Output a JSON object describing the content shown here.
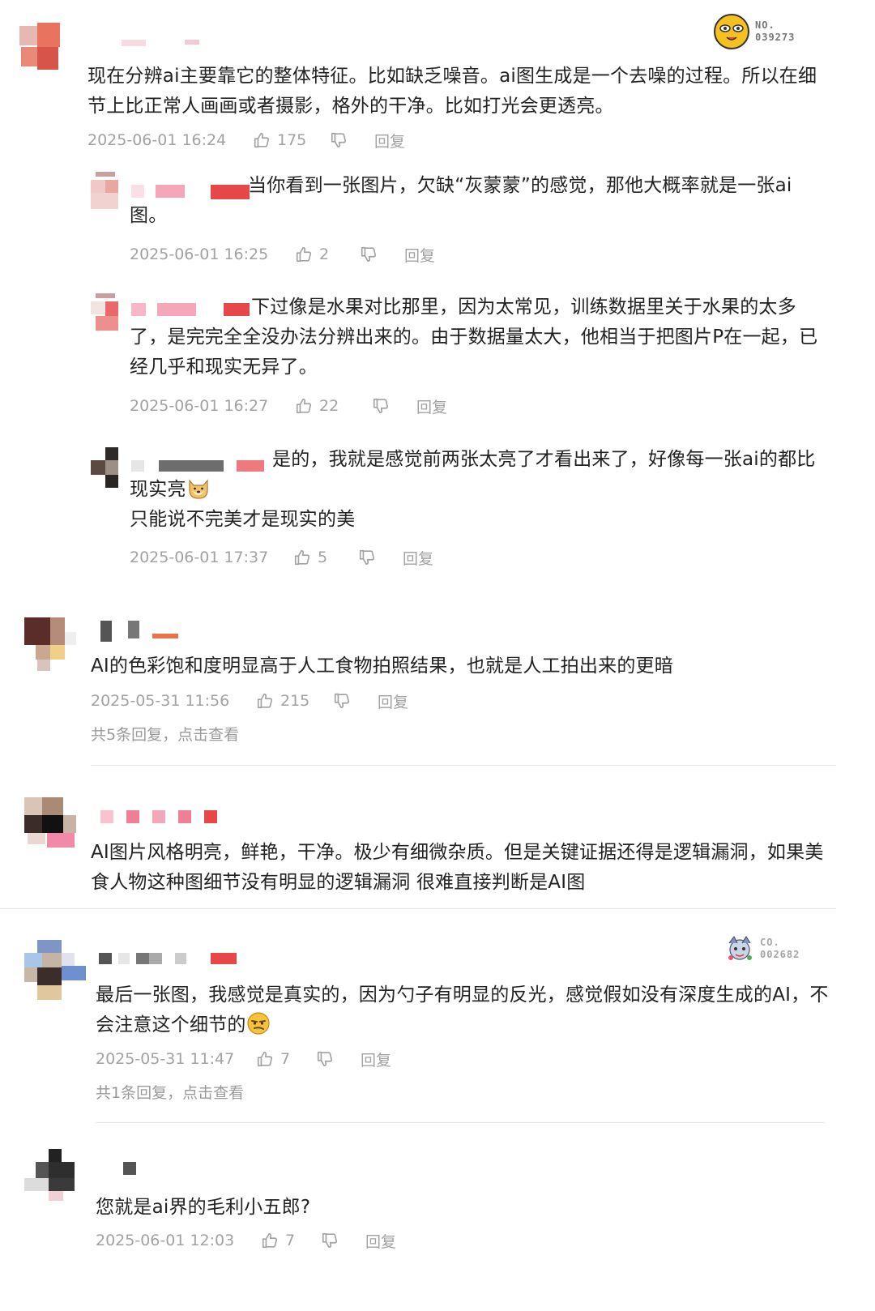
{
  "comments": [
    {
      "text_lines": [
        "现在分辨ai主要靠它的整体特征。比如缺乏噪音。ai图生成是一个去噪的过程。所以在细",
        "节上比正常人画画或者摄影，格外的干净。比如打光会更透亮。"
      ],
      "time": "2025-06-01 16:24",
      "likes": "175",
      "reply_label": "回复",
      "badge": {
        "line1": "NO.",
        "line2": "039273"
      }
    },
    {
      "text_lines": [
        "当你看到一张图片，欠缺“灰蒙蒙”的感觉，那他大概率就是一张ai",
        "图。"
      ],
      "time": "2025-06-01 16:25",
      "likes": "2",
      "reply_label": "回复"
    },
    {
      "text_lines": [
        "下过像是水果对比那里，因为太常见，训练数据里关于水果的太多",
        "了，是完完全全没办法分辨出来的。由于数据量太大，他相当于把图片P在一起，已",
        "经几乎和现实无异了。"
      ],
      "time": "2025-06-01 16:27",
      "likes": "22",
      "reply_label": "回复"
    },
    {
      "text_lines": [
        "是的，我就是感觉前两张太亮了才看出来了，好像每一张ai的都比",
        "现实亮",
        "只能说不完美才是现实的美"
      ],
      "time": "2025-06-01 17:37",
      "likes": "5",
      "reply_label": "回复"
    },
    {
      "text_lines": [
        "AI的色彩饱和度明显高于人工食物拍照结果，也就是人工拍出来的更暗"
      ],
      "time": "2025-05-31 11:56",
      "likes": "215",
      "reply_label": "回复",
      "more": "共5条回复，点击查看"
    },
    {
      "text_lines": [
        "AI图片风格明亮，鲜艳，干净。极少有细微杂质。但是关键证据还得是逻辑漏洞，如果美",
        "食人物这种图细节没有明显的逻辑漏洞 很难直接判断是AI图"
      ]
    },
    {
      "text_lines": [
        "最后一张图，我感觉是真实的，因为勺子有明显的反光，感觉假如没有深度生成的AI，不",
        "会注意这个细节的"
      ],
      "time": "2025-05-31 11:47",
      "likes": "7",
      "reply_label": "回复",
      "more": "共1条回复，点击查看",
      "badge": {
        "line1": "CO.",
        "line2": "002682"
      }
    },
    {
      "text_lines": [
        "您就是ai界的毛利小五郎?"
      ],
      "time": "2025-06-01 12:03",
      "likes": "7",
      "reply_label": "回复"
    }
  ],
  "icons": {
    "like": "thumbs-up-icon",
    "dislike": "thumbs-down-icon",
    "doge": "doge-emoji",
    "smirk": "smirk-emoji"
  },
  "colors": {
    "text": "#222222",
    "meta": "#a2a2a2",
    "accent_red": "#e8474a",
    "pink": "#f4a7b9"
  }
}
